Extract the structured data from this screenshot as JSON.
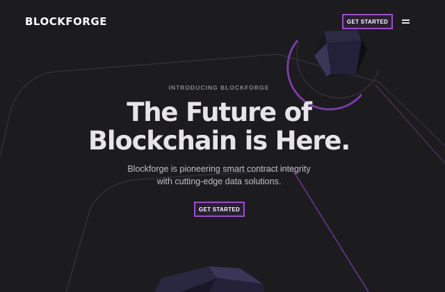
{
  "brand": {
    "logo_text": "BLOCKFORGE"
  },
  "nav": {
    "cta_label": "GET STARTED",
    "menu_icon": "hamburger-menu-icon"
  },
  "hero": {
    "eyebrow": "INTRODUCING BLOCKFORGE",
    "headline_line1": "The Future of",
    "headline_line2": "Blockchain is Here.",
    "subtitle_line1": "Blockforge is pioneering smart contract integrity",
    "subtitle_line2": "with cutting-edge data solutions.",
    "cta_label": "GET STARTED"
  },
  "colors": {
    "background": "#1c1b1e",
    "accent": "#9b4dcf",
    "headline": "#e6e4e8",
    "muted": "#8a8690"
  }
}
